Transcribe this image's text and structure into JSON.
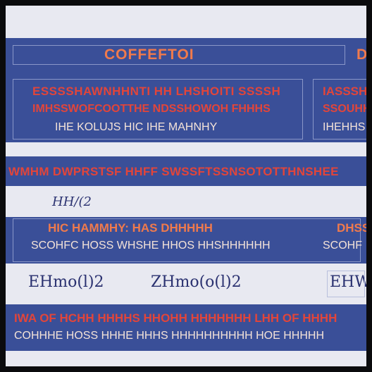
{
  "colors": {
    "frame": "#0b0b0d",
    "band_blue": "#3a4f98",
    "band_light": "#e8e9f1",
    "orange": "#f07a4c",
    "red": "#e2453a",
    "cream": "#f4e3d8"
  },
  "header": {
    "title": "COFFEFTOI",
    "right_fragment": "D"
  },
  "block1": {
    "line1": "ESSSSHAWNHHNTI HH LHSHOITI SSSSH",
    "line2": "IMHSSWOFCOOTTHE NDSSHOWOH FHHHS",
    "line3": "IHE KOLUJS HIC IHE MAHNHY",
    "right_line1": "IASSSHH",
    "right_line2": "SSOUHHS",
    "right_line3": "IHEHHS"
  },
  "strip": {
    "text": "WMHM DWPRSTSF HHFF SWSSFTSSNSOTOTTHNSHEE"
  },
  "light1": {
    "formula": "HH/(2"
  },
  "block2": {
    "line1": "HIC HAMMHY: HAS DHHHHH",
    "line2": "SCOHFC HOSS WHSHE HHOS HHSHHHHHH",
    "right_line1": "DHSS",
    "right_line2": "SCOHF"
  },
  "light2": {
    "formula1": "EHmo(l)2",
    "formula2": "ZHmo(o(l)2",
    "formula3": "EHW"
  },
  "block3": {
    "line1": "IWA OF HCHH HHHHS HHOHH HHHHHHH LHH OF HHHH",
    "line2": "COHHHE HOSS HHHE HHHS HHHHHHHHHH HOE HHHHH"
  }
}
